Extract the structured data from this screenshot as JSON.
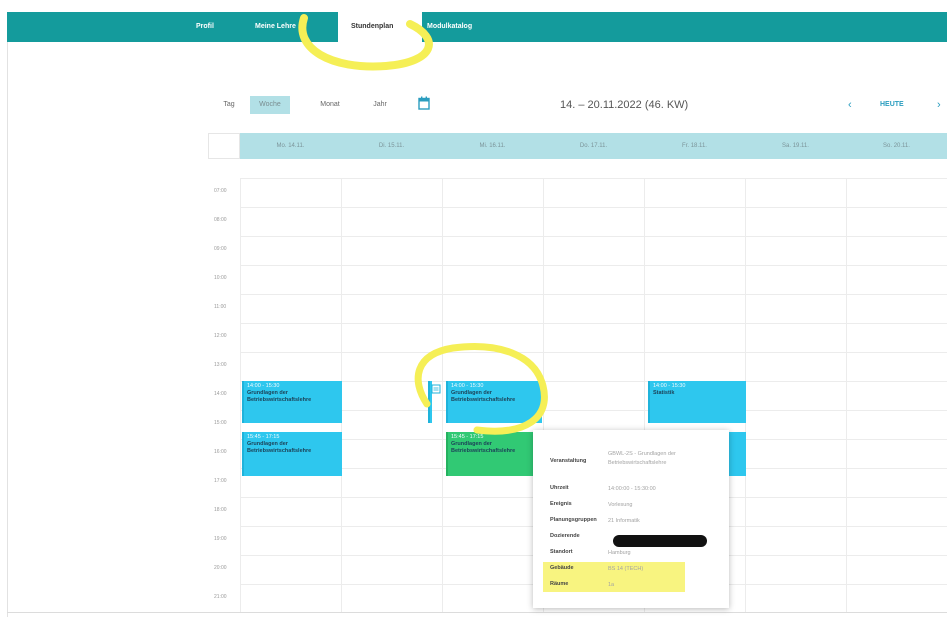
{
  "nav": {
    "items": [
      {
        "label": "Profil"
      },
      {
        "label": "Meine Lehre",
        "has_dropdown": true
      },
      {
        "label": "Stundenplan",
        "active": true
      },
      {
        "label": "Modulkatalog"
      }
    ]
  },
  "toolbar": {
    "views": [
      "Tag",
      "Woche",
      "Monat",
      "Jahr"
    ],
    "active_view": "Woche",
    "calendar_icon": "calendar-icon",
    "week_title": "14. – 20.11.2022 (46. KW)",
    "prev_label": "‹",
    "today_label": "HEUTE",
    "next_label": "›"
  },
  "days": [
    "Mo. 14.11.",
    "Di. 15.11.",
    "Mi. 16.11.",
    "Do. 17.11.",
    "Fr. 18.11.",
    "Sa. 19.11.",
    "So. 20.11."
  ],
  "times": [
    "07:00",
    "08:00",
    "09:00",
    "10:00",
    "11:00",
    "12:00",
    "13:00",
    "14:00",
    "15:00",
    "16:00",
    "17:00",
    "18:00",
    "19:00",
    "20:00",
    "21:00"
  ],
  "events": [
    {
      "time": "14:00 - 15:30",
      "title": "Grundlagen der",
      "title2": "Betriebswirtschaftslehre"
    },
    {
      "time": "15:45 - 17:15",
      "title": "Grundlagen der",
      "title2": "Betriebswirtschaftslehre"
    },
    {
      "time": "14:00 - 15:30",
      "title": "Grundlagen der",
      "title2": "Betriebswirtschaftslehre"
    },
    {
      "time": "15:45 - 17:15",
      "title": "Grundlagen der",
      "title2": "Betriebswirtschaftslehre"
    },
    {
      "time": "14:00 - 15:30",
      "title": "Statistik",
      "title2": ""
    }
  ],
  "popup": {
    "rows": [
      {
        "label": "Veranstaltung",
        "value": "GBWL-2S - Grundlagen der Betriebswirtschaftslehre"
      },
      {
        "label": "Uhrzeit",
        "value": "14:00:00 - 15:30:00"
      },
      {
        "label": "Ereignis",
        "value": "Vorlesung"
      },
      {
        "label": "Planungsgruppen",
        "value": "21 Informatik"
      },
      {
        "label": "Dozierende",
        "value": ""
      },
      {
        "label": "Standort",
        "value": "Hamburg"
      },
      {
        "label": "Gebäude",
        "value": "BS 14 (TECH)"
      },
      {
        "label": "Räume",
        "value": "1a"
      }
    ]
  },
  "colors": {
    "nav_bg": "#149b9c",
    "header_bg": "#b2e0e6",
    "event_blue": "#2ec7ee",
    "event_green": "#31c974",
    "link_blue": "#2a9dbf",
    "highlight_yellow": "#f5ef56"
  }
}
